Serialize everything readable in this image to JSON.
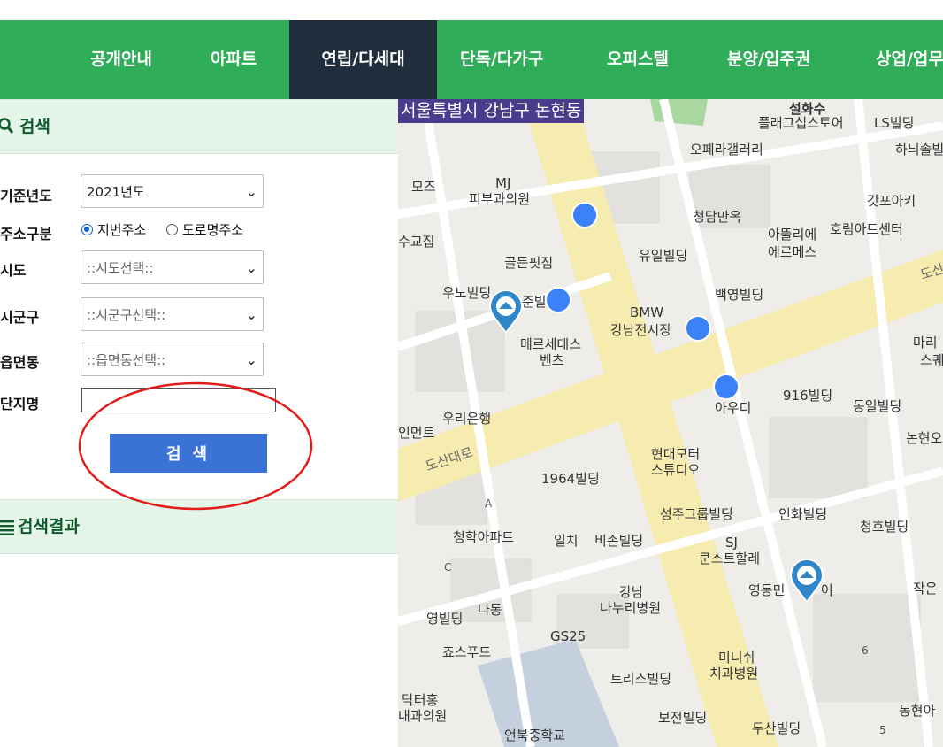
{
  "nav": {
    "items": [
      "공개안내",
      "아파트",
      "연립/다세대",
      "단독/다가구",
      "오피스텔",
      "분양/입주권",
      "상업/업무"
    ],
    "active": "연립/다세대"
  },
  "search_panel": {
    "title": "검색",
    "fields": {
      "year_label": "기준년도",
      "year_value": "2021년도",
      "addr_type_label": "주소구분",
      "addr_options": [
        "지번주소",
        "도로명주소"
      ],
      "addr_selected": "지번주소",
      "sido_label": "시도",
      "sido_value": "::시도선택::",
      "sigungu_label": "시군구",
      "sigungu_value": "::시군구선택::",
      "dong_label": "읍면동",
      "dong_value": "::읍면동선택::",
      "complex_label": "단지명",
      "complex_value": ""
    },
    "search_button": "검 색"
  },
  "results": {
    "title": "검색결과"
  },
  "map": {
    "location_banner": "서울특별시 강남구 논현동",
    "labels": [
      "설화수",
      "플래그십스토어",
      "LS빌딩",
      "하늬솔빌",
      "오페라갤러리",
      "MJ",
      "피부과의원",
      "모즈",
      "갓포아키",
      "청담만옥",
      "아뜰리에",
      "에르메스",
      "호림아트센터",
      "수교집",
      "골든핏짐",
      "유일빌딩",
      "우노빌딩",
      "준빌",
      "백영빌딩",
      "BMW",
      "강남전시장",
      "메르세데스",
      "벤츠",
      "마리",
      "스퀘",
      "아우디",
      "916빌딩",
      "동일빌딩",
      "우리은행",
      "인먼트",
      "논현오",
      "도산대로",
      "현대모터",
      "스튜디오",
      "1964빌딩",
      "성주그룹빌딩",
      "인화빌딩",
      "청호빌딩",
      "청학아파트",
      "일치",
      "비손빌딩",
      "SJ",
      "쿤스트할레",
      "영동민",
      "어",
      "작은",
      "강남",
      "나누리병원",
      "나동",
      "영빌딩",
      "GS25",
      "죠스푸드",
      "미니쉬",
      "치과병원",
      "트리스빌딩",
      "닥터홍",
      "내과의원",
      "보전빌딩",
      "두산빌딩",
      "동현아",
      "언북중학교",
      "도산",
      "A",
      "C",
      "6",
      "5"
    ]
  },
  "colors": {
    "nav_bg": "#30ad58",
    "nav_active": "#1f2d3d",
    "button": "#3a73d4",
    "annotation_circle": "#e21b1b"
  }
}
